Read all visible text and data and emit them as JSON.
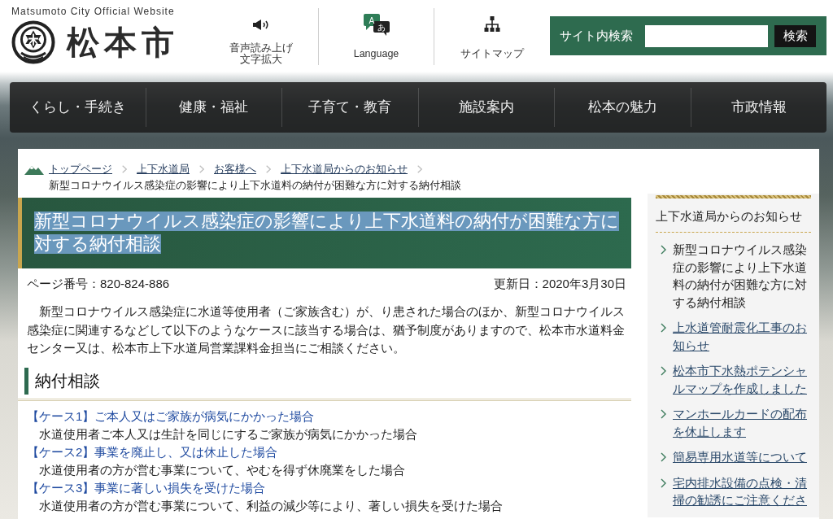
{
  "header": {
    "tagline": "Matsumoto City Official Website",
    "logo_text": "松本市",
    "utility_links": [
      {
        "kind": "read_aloud",
        "label_lines": [
          "音声読み上げ",
          "文字拡大"
        ]
      },
      {
        "kind": "language",
        "icon_labels": [
          "A",
          "あ"
        ],
        "label_lines": [
          "Language"
        ]
      },
      {
        "kind": "sitemap",
        "label_lines": [
          "サイトマップ"
        ]
      }
    ],
    "search": {
      "label": "サイト内検索",
      "button": "検索"
    }
  },
  "nav": [
    {
      "label": "くらし・手続き"
    },
    {
      "label": "健康・福祉"
    },
    {
      "label": "子育て・教育"
    },
    {
      "label": "施設案内"
    },
    {
      "label": "松本の魅力"
    },
    {
      "label": "市政情報"
    }
  ],
  "breadcrumb": {
    "links": [
      "トップページ",
      "上下水道局",
      "お客様へ",
      "上下水道局からのお知らせ"
    ],
    "current": "新型コロナウイルス感染症の影響により上下水道料の納付が困難な方に対する納付相談"
  },
  "page_title": {
    "text": "新型コロナウイルス感染症の影響により上下水道料の納付が困難な方に対する納付相談",
    "text_selected": true
  },
  "page_number": "ページ番号：820-824-886",
  "updated": "更新日：2020年3月30日",
  "intro": "新型コロナウイルス感染症に水道等使用者（ご家族含む）が、り患された場合のほか、新型コロナウイルス感染症に関連するなどして以下のようなケースに該当する場合は、猶予制度がありますので、松本市水道料金センター又は、松本市上下水道局営業課料金担当にご相談ください。",
  "section_heading": "納付相談",
  "cases": [
    {
      "title": "【ケース1】ご本人又はご家族が病気にかかった場合",
      "description": "水道使用者ご本人又は生計を同じにするご家族が病気にかかった場合"
    },
    {
      "title": "【ケース2】事業を廃止し、又は休止した場合",
      "description": "水道使用者の方が営む事業について、やむを得ず休廃業をした場合"
    },
    {
      "title": "【ケース3】事業に著しい損失を受けた場合",
      "description": "水道使用者の方が営む事業について、利益の減少等により、著しい損失を受けた場合"
    }
  ],
  "sidebar": {
    "heading": "上下水道局からのお知らせ",
    "items": [
      {
        "label": "新型コロナウイルス感染症の影響により上下水道料の納付が困難な方に対する納付相談",
        "selected": true
      },
      {
        "label": "上水道管耐震化工事のお知らせ",
        "selected": false
      },
      {
        "label": "松本市下水熱ポテンシャルマップを作成しました",
        "selected": false
      },
      {
        "label": "マンホールカードの配布を休止します",
        "selected": false
      },
      {
        "label": "簡易専用水道等について",
        "selected": false
      },
      {
        "label": "宅内排水設備の点検・清掃の勧誘にご注意くださ",
        "selected": false
      }
    ]
  }
}
